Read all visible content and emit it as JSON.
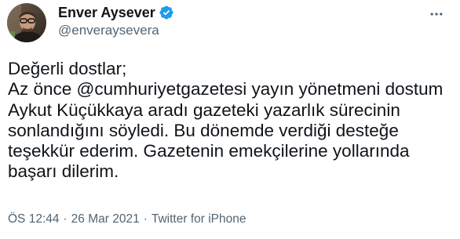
{
  "author": {
    "display_name": "Enver Aysever",
    "handle": "@enveraysevera",
    "verified": true,
    "avatar_icon": "avatar-photo",
    "verified_icon": "verified-badge-icon",
    "verified_color": "#1d9bf0"
  },
  "more_icon": "more-horizontal-icon",
  "tweet": {
    "text": "Değerli dostlar;\nAz önce @cumhuriyetgazetesi yayın yönetmeni dostum Aykut Küçükkaya aradı gazeteki yazarlık sürecinin sonlandığını söyledi. Bu dönemde verdiği desteğe teşekkür ederim. Gazetenin emekçilerine yollarında başarı dilerim."
  },
  "meta": {
    "time": "ÖS 12:44",
    "separator": "·",
    "date": "26 Mar 2021",
    "source": "Twitter for iPhone"
  },
  "colors": {
    "text_primary": "#0f1419",
    "text_secondary": "#536471"
  }
}
